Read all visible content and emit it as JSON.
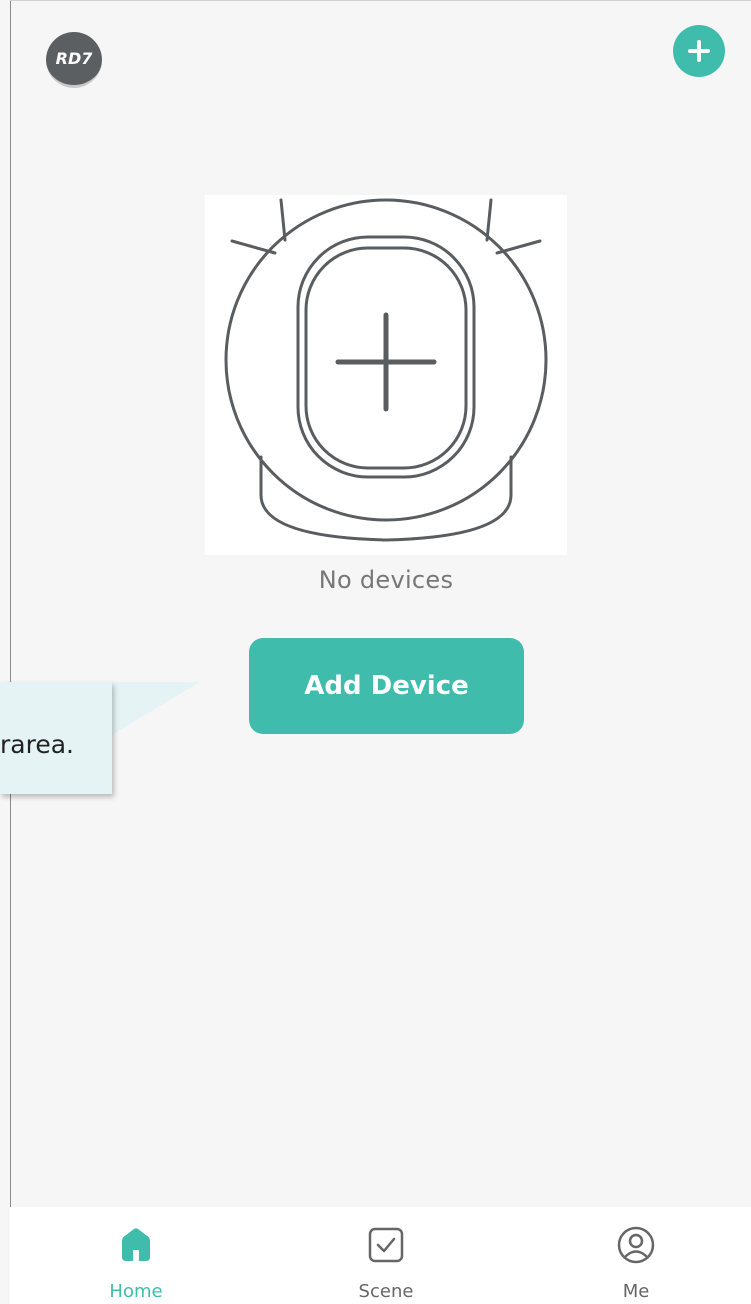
{
  "header": {
    "avatar_text": "RD7",
    "add_icon": "plus-icon"
  },
  "colors": {
    "accent": "#40bcad",
    "background": "#f6f6f6",
    "tooltip_bg": "#e5f3f5"
  },
  "empty_state": {
    "illustration": "robot-vacuum-plus-illustration",
    "message": "No devices",
    "button_label": "Add Device"
  },
  "tooltip": {
    "text": "rarea."
  },
  "tabbar": {
    "tabs": [
      {
        "label": "Home",
        "icon": "home-icon",
        "active": true
      },
      {
        "label": "Scene",
        "icon": "checkbox-icon",
        "active": false
      },
      {
        "label": "Me",
        "icon": "profile-icon",
        "active": false
      }
    ]
  }
}
